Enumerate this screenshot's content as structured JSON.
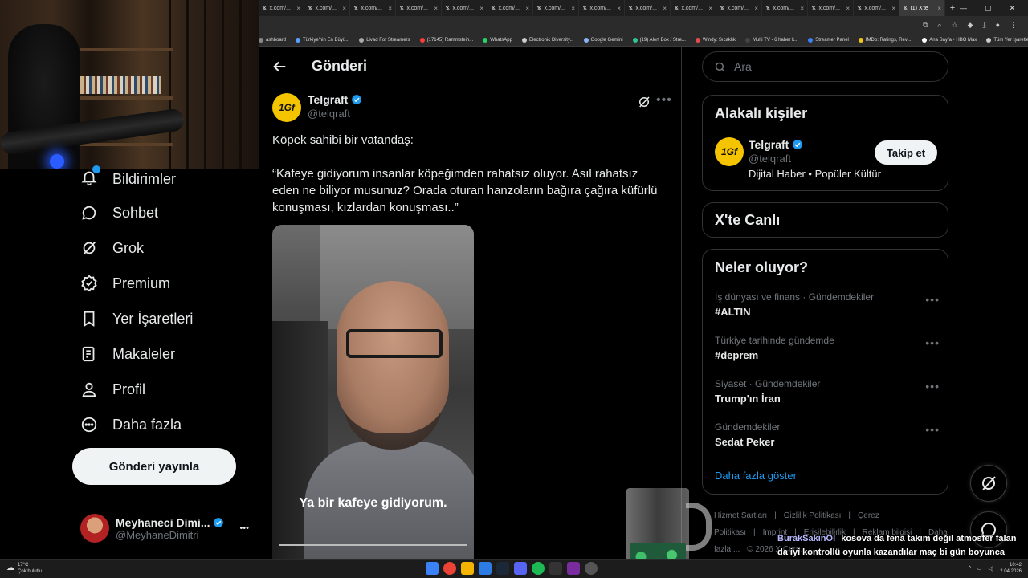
{
  "browser": {
    "tabs": [
      {
        "label": "x.com/..."
      },
      {
        "label": "x.com/..."
      },
      {
        "label": "x.com/..."
      },
      {
        "label": "x.com/..."
      },
      {
        "label": "x.com/..."
      },
      {
        "label": "x.com/..."
      },
      {
        "label": "x.com/..."
      },
      {
        "label": "x.com/..."
      },
      {
        "label": "x.com/..."
      },
      {
        "label": "x.com/..."
      },
      {
        "label": "x.com/..."
      },
      {
        "label": "x.com/..."
      },
      {
        "label": "x.com/..."
      },
      {
        "label": "x.com/..."
      },
      {
        "label": "(1) X'te"
      }
    ],
    "bookmarks": [
      {
        "label": "ashboard",
        "color": "#888888"
      },
      {
        "label": "Türkiye'nin En Büyü...",
        "color": "#5aa0ff"
      },
      {
        "label": "Livad For Streamers",
        "color": "#aaaaaa"
      },
      {
        "label": "(17145) Rammstein...",
        "color": "#ff3b3b"
      },
      {
        "label": "WhatsApp",
        "color": "#25d366"
      },
      {
        "label": "Electronic Diversity...",
        "color": "#cccccc"
      },
      {
        "label": "Google Gemini",
        "color": "#8ab4f8"
      },
      {
        "label": "(19) Alert Box / Stre...",
        "color": "#31c48d"
      },
      {
        "label": "Windy: Sıcaklık",
        "color": "#e34b4b"
      },
      {
        "label": "Multi TV - 6 haber k...",
        "color": "#444444"
      },
      {
        "label": "Streamer Panel",
        "color": "#3b82f6"
      },
      {
        "label": "IMDb: Ratings, Revi...",
        "color": "#f5c518"
      },
      {
        "label": "Ana Sayfa • HBO Max",
        "color": "#ffffff"
      },
      {
        "label": "Tüm Yer İşaretleri",
        "color": "#cccccc"
      }
    ]
  },
  "nav": {
    "items": [
      {
        "label": "Bildirimler",
        "icon": "bell-icon"
      },
      {
        "label": "Sohbet",
        "icon": "chat-icon"
      },
      {
        "label": "Grok",
        "icon": "grok-icon"
      },
      {
        "label": "Premium",
        "icon": "premium-icon"
      },
      {
        "label": "Yer İşaretleri",
        "icon": "bookmark-icon"
      },
      {
        "label": "Makaleler",
        "icon": "article-icon"
      },
      {
        "label": "Profil",
        "icon": "profile-icon"
      },
      {
        "label": "Daha fazla",
        "icon": "more-circle-icon"
      }
    ],
    "post_button": "Gönderi yayınla",
    "account": {
      "name": "Meyhaneci Dimi...",
      "handle": "@MeyhaneDimitri",
      "more": "•••"
    }
  },
  "main": {
    "title": "Gönderi",
    "post": {
      "author": "Telgraft",
      "handle": "@telqraft",
      "avatar_text": "1Gf",
      "text": "Köpek sahibi bir vatandaş:\n\n“Kafeye gidiyorum insanlar köpeğimden rahatsız oluyor. Asıl rahatsız eden ne biliyor musunuz? Orada oturan hanzoların bağıra çağıra küfürlü konuşması, kızlardan konuşması..”",
      "video_caption": "Ya bir kafeye gidiyorum.",
      "more": "•••"
    }
  },
  "right": {
    "search_placeholder": "Ara",
    "related": {
      "title": "Alakalı kişiler",
      "name": "Telgraft",
      "handle": "@telqraft",
      "bio": "Dijital Haber • Popüler Kültür",
      "follow": "Takip et"
    },
    "live": {
      "title": "X'te Canlı"
    },
    "trends": {
      "title": "Neler oluyor?",
      "items": [
        {
          "meta": "İş dünyası ve finans · Gündemdekiler",
          "name": "#ALTIN"
        },
        {
          "meta": "Türkiye tarihinde gündemde",
          "name": "#deprem"
        },
        {
          "meta": "Siyaset · Gündemdekiler",
          "name": "Trump'ın İran"
        },
        {
          "meta": "Gündemdekiler",
          "name": "Sedat Peker"
        }
      ],
      "show_more": "Daha fazla göster"
    },
    "footer": [
      "Hizmet Şartları",
      "|",
      "Gizlilik Politikası",
      "|",
      "Çerez Politikası",
      "|",
      "Imprint",
      "|",
      "Erişilebilirlik",
      "|",
      "Reklam bilgisi",
      "|",
      "Daha fazla ...",
      "© 2026 X Corp."
    ]
  },
  "overlay": {
    "chat_user": "BurakSakinOl",
    "chat_message": "kosova da fena takım değil atmosfer falan da iyi kontrollü oyunla kazandılar maç bi gün boyunca oynansa yine kazanırdık"
  },
  "taskbar": {
    "weather_temp": "17°C",
    "weather_desc": "Çok bulutlu",
    "time": "10:42",
    "date": "2.04.2026"
  },
  "colors": {
    "accent": "#1d9bf0",
    "background": "#000000",
    "border": "#2f3336",
    "muted": "#71767b"
  }
}
